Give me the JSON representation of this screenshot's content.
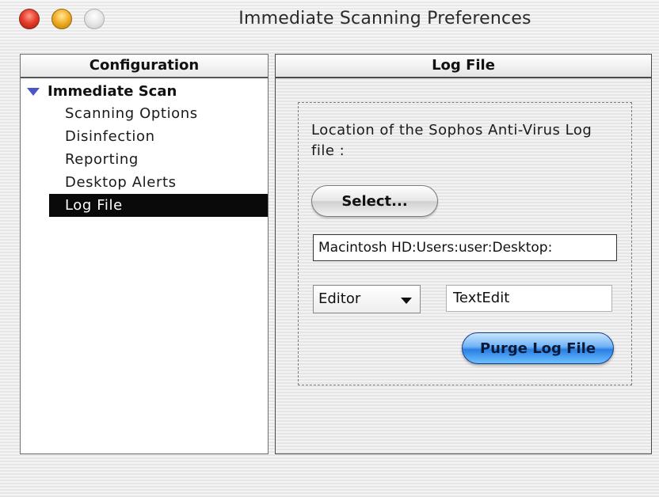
{
  "window": {
    "title": "Immediate Scanning Preferences"
  },
  "config": {
    "header": "Configuration",
    "parent": "Immediate Scan",
    "items": [
      {
        "label": "Scanning Options",
        "selected": false
      },
      {
        "label": "Disinfection",
        "selected": false
      },
      {
        "label": "Reporting",
        "selected": false
      },
      {
        "label": "Desktop Alerts",
        "selected": false
      },
      {
        "label": "Log File",
        "selected": true
      }
    ]
  },
  "log": {
    "header": "Log File",
    "location_label": "Location of the Sophos Anti-Virus Log file :",
    "select_button": "Select...",
    "path_value": "Macintosh HD:Users:user:Desktop:",
    "editor_popup": "Editor",
    "editor_value": "TextEdit",
    "purge_button": "Purge Log File"
  },
  "icons": {
    "close": "close-icon",
    "minimize": "minimize-icon",
    "zoom": "zoom-icon",
    "disclosure": "disclosure-triangle-icon",
    "popup_arrow": "chevron-down-icon"
  },
  "colors": {
    "selection": "#0a0a0a",
    "disclosure": "#4a56c8",
    "purge_button": "#2a7fe3"
  }
}
